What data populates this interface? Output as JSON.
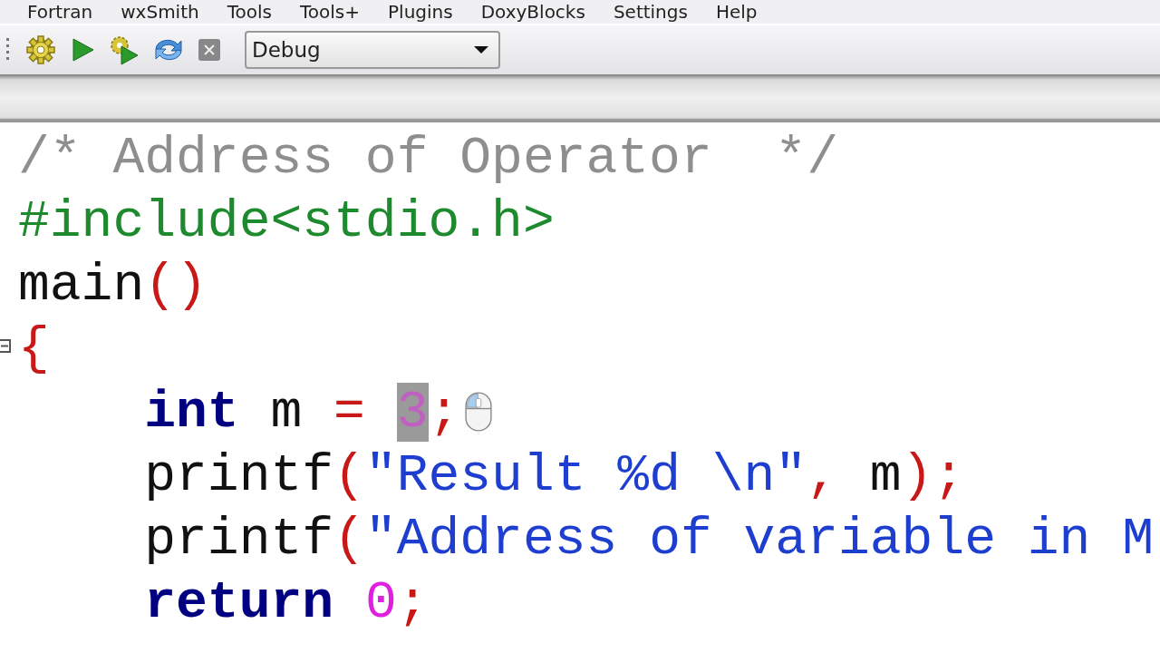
{
  "menu": [
    "Fortran",
    "wxSmith",
    "Tools",
    "Tools+",
    "Plugins",
    "DoxyBlocks",
    "Settings",
    "Help"
  ],
  "toolbar": {
    "build_target": "Debug"
  },
  "editor": {
    "lines": [
      {
        "folded": false,
        "tokens": [
          {
            "kind": "comment",
            "text": "/* Address of Operator  */",
            "selected": false
          }
        ]
      },
      {
        "folded": false,
        "tokens": [
          {
            "kind": "preprocessor",
            "text": "#include<stdio.h>",
            "selected": false
          }
        ]
      },
      {
        "folded": false,
        "tokens": [
          {
            "kind": "plain",
            "text": "main",
            "selected": false
          },
          {
            "kind": "operator",
            "text": "()",
            "selected": false
          }
        ]
      },
      {
        "folded": true,
        "tokens": [
          {
            "kind": "operator",
            "text": "{",
            "selected": false
          }
        ]
      },
      {
        "folded": false,
        "tokens": [
          {
            "kind": "keyword",
            "text": "    int",
            "selected": false
          },
          {
            "kind": "plain",
            "text": " m ",
            "selected": false
          },
          {
            "kind": "operator",
            "text": "= ",
            "selected": false
          },
          {
            "kind": "number",
            "text": "3",
            "selected": true
          },
          {
            "kind": "operator",
            "text": ";",
            "selected": false
          }
        ]
      },
      {
        "folded": false,
        "tokens": [
          {
            "kind": "plain",
            "text": "    printf",
            "selected": false
          },
          {
            "kind": "operator",
            "text": "(",
            "selected": false
          },
          {
            "kind": "string",
            "text": "\"Result %d \\n\"",
            "selected": false
          },
          {
            "kind": "operator",
            "text": ",",
            "selected": false
          },
          {
            "kind": "plain",
            "text": " m",
            "selected": false
          },
          {
            "kind": "operator",
            "text": ");",
            "selected": false
          }
        ]
      },
      {
        "folded": false,
        "tokens": [
          {
            "kind": "plain",
            "text": "    printf",
            "selected": false
          },
          {
            "kind": "operator",
            "text": "(",
            "selected": false
          },
          {
            "kind": "string",
            "text": "\"Address of variable in M",
            "selected": false
          }
        ]
      },
      {
        "folded": false,
        "tokens": [
          {
            "kind": "keyword",
            "text": "    return ",
            "selected": false
          },
          {
            "kind": "number",
            "text": "0",
            "selected": false
          },
          {
            "kind": "operator",
            "text": ";",
            "selected": false
          }
        ]
      }
    ]
  }
}
